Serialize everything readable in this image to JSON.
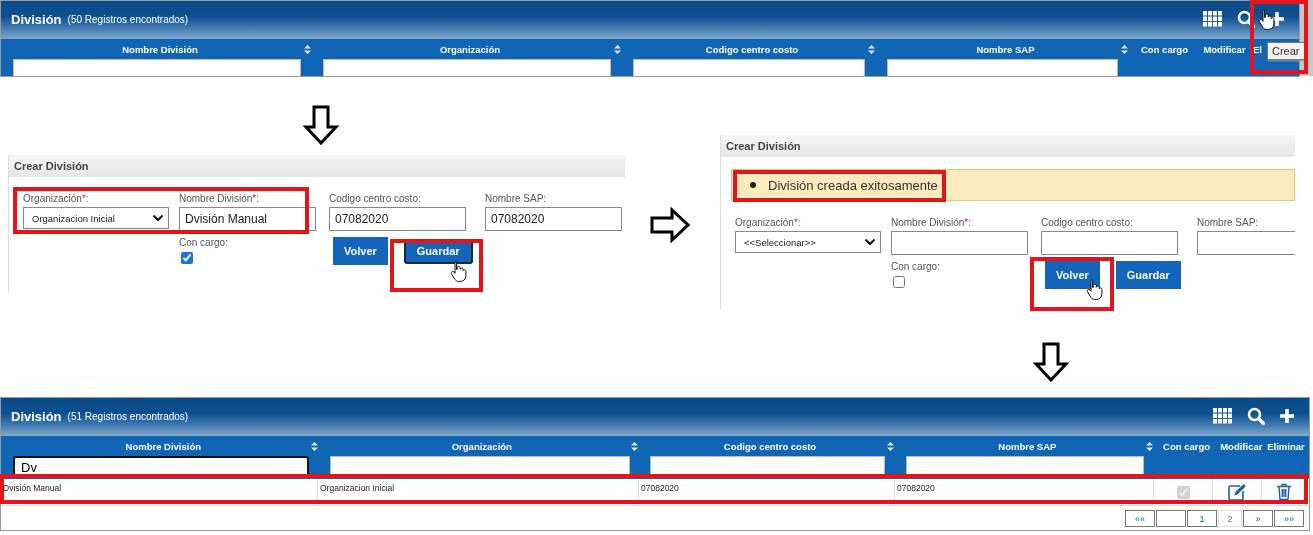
{
  "list_before": {
    "title": "División",
    "count": "(50 Registros encontrados)",
    "tooltip": "Crear",
    "columns": [
      {
        "label": "Nombre División",
        "sortable": true,
        "filterable": true,
        "focused": false
      },
      {
        "label": "Organización",
        "sortable": true,
        "filterable": true,
        "focused": false
      },
      {
        "label": "Codigo centro costo",
        "sortable": true,
        "filterable": true,
        "focused": false
      },
      {
        "label": "Nombre SAP",
        "sortable": true,
        "filterable": true,
        "focused": false
      },
      {
        "label": "Con cargo",
        "sortable": false,
        "filterable": false
      },
      {
        "label": "Modificar",
        "sortable": false,
        "filterable": false
      },
      {
        "label": "El"
      }
    ]
  },
  "create_form": {
    "title": "Crear División",
    "fields": [
      {
        "kind": "select",
        "label": "Organización",
        "required_mark": "*",
        "suffix": ":",
        "value": "Organizacion Inicial"
      },
      {
        "kind": "input",
        "label": "Nombre División",
        "required_mark": "*",
        "suffix": ":",
        "value": "Dvisión Manual"
      },
      {
        "kind": "input",
        "label": "Codigo centro costo:",
        "value": "07082020"
      },
      {
        "kind": "input",
        "label": "Nombre SAP:",
        "value": "07082020"
      }
    ],
    "con_cargo": {
      "label": "Con cargo:",
      "checked": true
    },
    "buttons": [
      {
        "label": "Volver",
        "focused": false
      },
      {
        "label": "Guardar",
        "focused": true
      }
    ]
  },
  "create_form_saved": {
    "title": "Crear División",
    "alert": "División creada exitosamente",
    "fields": [
      {
        "kind": "select",
        "label": "Organización",
        "required_mark": "*",
        "suffix": ":",
        "value": "<<Seleccionar>>"
      },
      {
        "kind": "input",
        "label": "Nombre División",
        "required_mark": "*",
        "suffix": ":"
      },
      {
        "kind": "input",
        "label": "Codigo centro costo:"
      },
      {
        "kind": "input",
        "label": "Nombre SAP:"
      }
    ],
    "con_cargo": {
      "label": "Con cargo:",
      "checked": false
    },
    "buttons": [
      {
        "label": "Volver",
        "focused": false
      },
      {
        "label": "Guardar",
        "focused": false
      }
    ]
  },
  "list_after": {
    "title": "División",
    "count": "(51 Registros encontrados)",
    "columns": [
      {
        "label": "Nombre División",
        "sortable": true,
        "filterable": true,
        "filter": "Dv",
        "focused": true
      },
      {
        "label": "Organización",
        "sortable": true,
        "filterable": true,
        "focused": false
      },
      {
        "label": "Codigo centro costo",
        "sortable": true,
        "filterable": true,
        "focused": false
      },
      {
        "label": "Nombre SAP",
        "sortable": true,
        "filterable": true,
        "focused": false
      },
      {
        "label": "Con cargo",
        "sortable": false,
        "filterable": false
      },
      {
        "label": "Modificar",
        "sortable": false,
        "filterable": false
      },
      {
        "label": "Eliminar",
        "sortable": false,
        "filterable": false
      }
    ],
    "rows": [
      {
        "cells": [
          "Dvisión Manual",
          "Organizacion Inicial",
          "07082020",
          "07082020"
        ],
        "con_cargo": true
      }
    ],
    "pagination": [
      {
        "label": "««",
        "selected": false
      },
      {
        "selected": false
      },
      {
        "label": "1",
        "selected": false
      },
      {
        "label": "2",
        "selected": true
      },
      {
        "label": "»",
        "selected": false
      },
      {
        "label": "»»",
        "selected": false
      }
    ]
  }
}
